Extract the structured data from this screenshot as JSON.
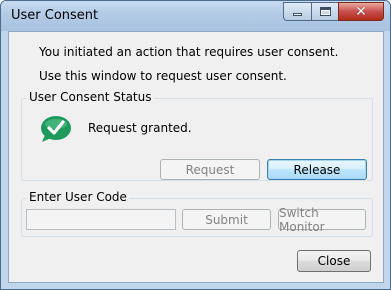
{
  "window": {
    "title": "User Consent",
    "controls": {
      "minimize_icon": "minimize-icon",
      "maximize_icon": "maximize-icon",
      "close_icon": "close-icon",
      "close_glyph": "✕"
    }
  },
  "messages": {
    "line1": "You initiated an action that requires user consent.",
    "line2": "Use this window to request user consent."
  },
  "consent_status": {
    "group_label": "User Consent Status",
    "status_icon": "check-circle-icon",
    "status_text": "Request granted.",
    "request_button": {
      "label": "Request",
      "enabled": false
    },
    "release_button": {
      "label": "Release",
      "enabled": true
    }
  },
  "user_code": {
    "group_label": "Enter User Code",
    "input_value": "",
    "submit_button": {
      "label": "Submit",
      "enabled": false
    },
    "switch_monitor_button": {
      "label": "Switch Monitor",
      "enabled": false
    }
  },
  "footer": {
    "close_button": {
      "label": "Close",
      "enabled": true
    }
  },
  "colors": {
    "titlebar": "#b3cbe6",
    "client_background": "#f0f0f0",
    "check_icon": "#1e9a5b",
    "close_control": "#c75050"
  }
}
